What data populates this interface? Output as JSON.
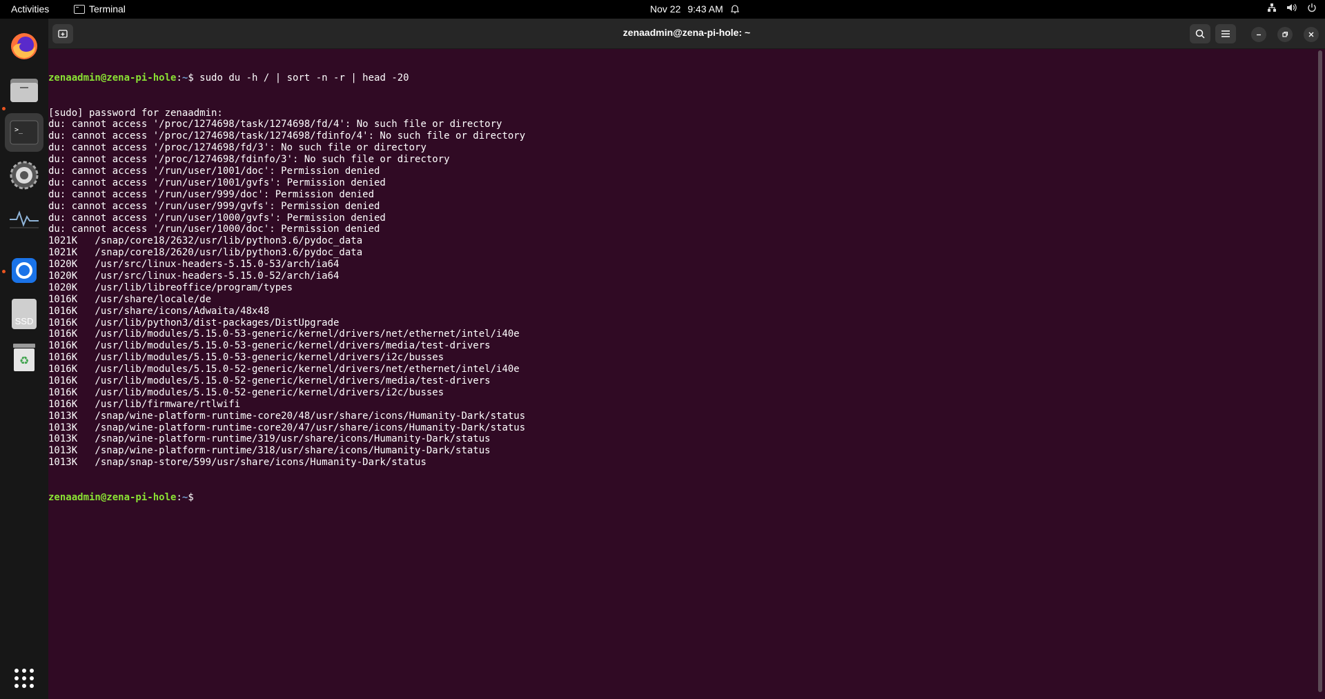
{
  "topbar": {
    "activities": "Activities",
    "app_name": "Terminal",
    "date": "Nov 22",
    "time": "9:43 AM"
  },
  "dock": {
    "items": [
      "firefox-icon",
      "files-icon",
      "terminal-icon",
      "settings-icon",
      "system-monitor-icon",
      "app-icon",
      "ssd-icon",
      "trash-icon"
    ],
    "ssd_label": "SSD"
  },
  "window": {
    "title": "zenaadmin@zena-pi-hole: ~"
  },
  "terminal": {
    "prompt_user": "zenaadmin@zena-pi-hole",
    "prompt_sep": ":",
    "prompt_path": "~",
    "prompt_symbol": "$ ",
    "command": "sudo du -h / | sort -n -r | head -20",
    "output": [
      "[sudo] password for zenaadmin:",
      "du: cannot access '/proc/1274698/task/1274698/fd/4': No such file or directory",
      "du: cannot access '/proc/1274698/task/1274698/fdinfo/4': No such file or directory",
      "du: cannot access '/proc/1274698/fd/3': No such file or directory",
      "du: cannot access '/proc/1274698/fdinfo/3': No such file or directory",
      "du: cannot access '/run/user/1001/doc': Permission denied",
      "du: cannot access '/run/user/1001/gvfs': Permission denied",
      "du: cannot access '/run/user/999/doc': Permission denied",
      "du: cannot access '/run/user/999/gvfs': Permission denied",
      "du: cannot access '/run/user/1000/gvfs': Permission denied",
      "du: cannot access '/run/user/1000/doc': Permission denied",
      "1021K\t/snap/core18/2632/usr/lib/python3.6/pydoc_data",
      "1021K\t/snap/core18/2620/usr/lib/python3.6/pydoc_data",
      "1020K\t/usr/src/linux-headers-5.15.0-53/arch/ia64",
      "1020K\t/usr/src/linux-headers-5.15.0-52/arch/ia64",
      "1020K\t/usr/lib/libreoffice/program/types",
      "1016K\t/usr/share/locale/de",
      "1016K\t/usr/share/icons/Adwaita/48x48",
      "1016K\t/usr/lib/python3/dist-packages/DistUpgrade",
      "1016K\t/usr/lib/modules/5.15.0-53-generic/kernel/drivers/net/ethernet/intel/i40e",
      "1016K\t/usr/lib/modules/5.15.0-53-generic/kernel/drivers/media/test-drivers",
      "1016K\t/usr/lib/modules/5.15.0-53-generic/kernel/drivers/i2c/busses",
      "1016K\t/usr/lib/modules/5.15.0-52-generic/kernel/drivers/net/ethernet/intel/i40e",
      "1016K\t/usr/lib/modules/5.15.0-52-generic/kernel/drivers/media/test-drivers",
      "1016K\t/usr/lib/modules/5.15.0-52-generic/kernel/drivers/i2c/busses",
      "1016K\t/usr/lib/firmware/rtlwifi",
      "1013K\t/snap/wine-platform-runtime-core20/48/usr/share/icons/Humanity-Dark/status",
      "1013K\t/snap/wine-platform-runtime-core20/47/usr/share/icons/Humanity-Dark/status",
      "1013K\t/snap/wine-platform-runtime/319/usr/share/icons/Humanity-Dark/status",
      "1013K\t/snap/wine-platform-runtime/318/usr/share/icons/Humanity-Dark/status",
      "1013K\t/snap/snap-store/599/usr/share/icons/Humanity-Dark/status"
    ]
  },
  "colors": {
    "terminal_bg": "#300a24",
    "prompt_user": "#8ae234",
    "prompt_path": "#729fcf",
    "accent": "#e95420"
  }
}
